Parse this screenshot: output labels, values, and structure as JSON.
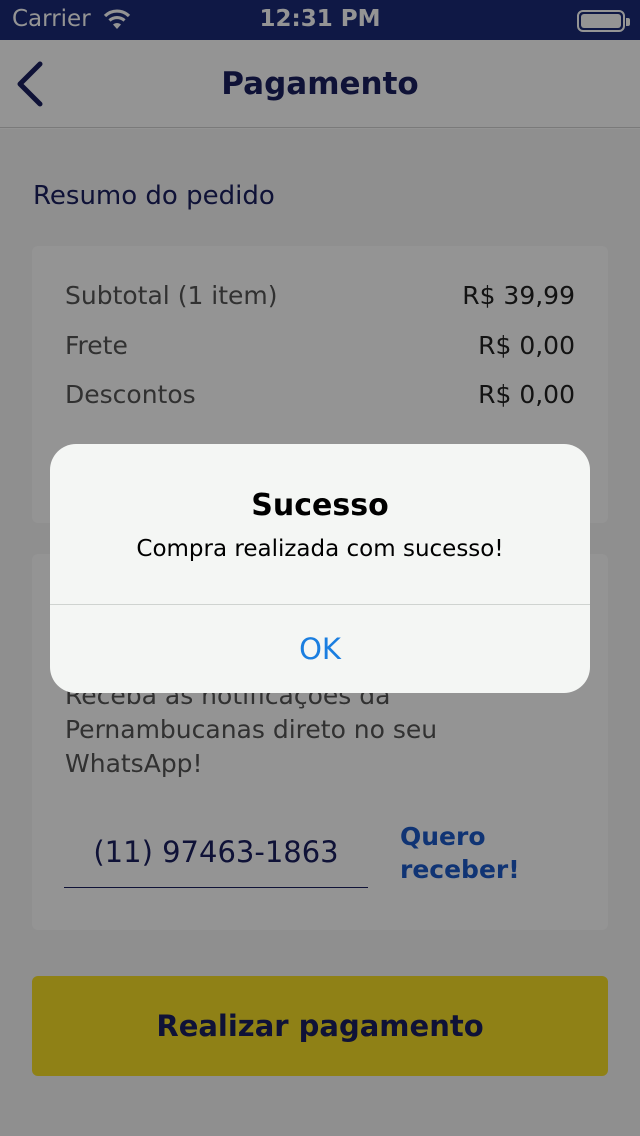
{
  "status_bar": {
    "carrier": "Carrier",
    "time": "12:31 PM"
  },
  "header": {
    "title": "Pagamento"
  },
  "summary": {
    "section_title": "Resumo do pedido",
    "rows": [
      {
        "label": "Subtotal (1 item)",
        "value": "R$ 39,99"
      },
      {
        "label": "Frete",
        "value": "R$ 0,00"
      },
      {
        "label": "Descontos",
        "value": "R$ 0,00"
      }
    ]
  },
  "whatsapp": {
    "description": "Receba as notificações da Pernambucanas direto no seu WhatsApp!",
    "phone_value": "(11) 97463-1863",
    "link_label": "Quero receber!"
  },
  "pay_button_label": "Realizar pagamento",
  "alert": {
    "title": "Sucesso",
    "message": "Compra realizada com sucesso!",
    "ok_label": "OK"
  },
  "colors": {
    "brand_blue": "#1a2060",
    "accent_yellow": "#f7de27",
    "link_blue": "#1d5ac8",
    "ios_blue": "#1a7ee0"
  }
}
